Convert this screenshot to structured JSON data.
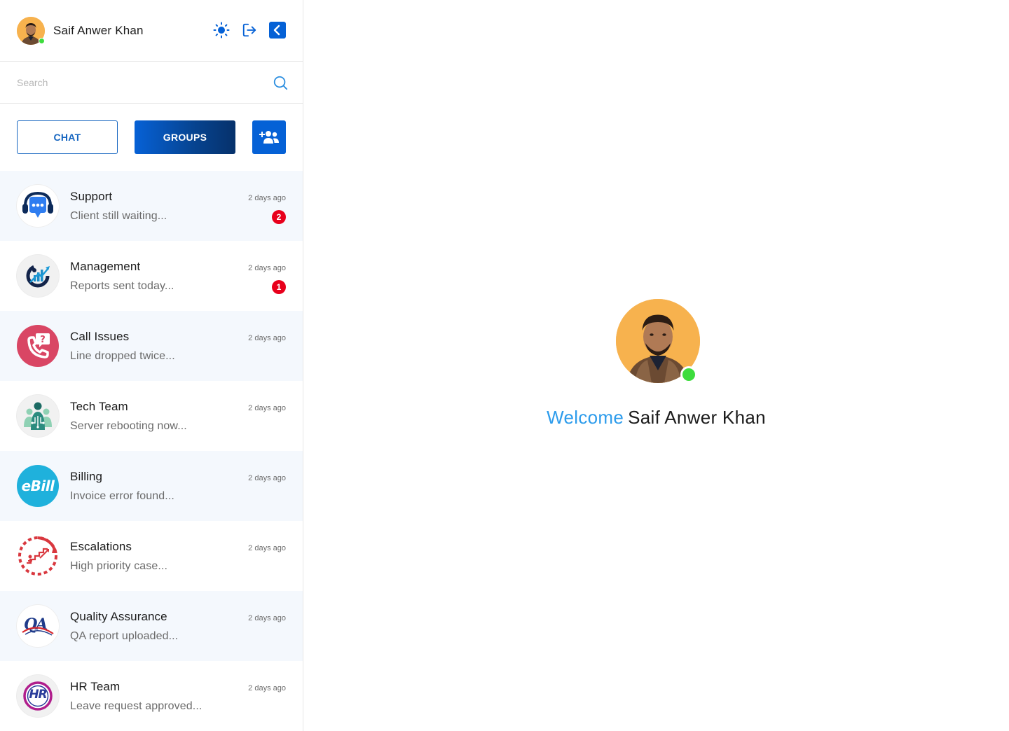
{
  "user": {
    "name": "Saif Anwer Khan",
    "status": "online"
  },
  "header": {
    "theme_icon": "sun-icon",
    "logout_icon": "logout-icon",
    "collapse_icon": "chevron-left-icon"
  },
  "search": {
    "placeholder": "Search",
    "value": "",
    "icon": "search-icon"
  },
  "tabs": {
    "chat_label": "CHAT",
    "groups_label": "GROUPS",
    "active": "GROUPS",
    "add_group_icon": "add-users-icon"
  },
  "groups": [
    {
      "name": "Support",
      "last_message": "Client still waiting...",
      "time": "2 days ago",
      "unread": "2",
      "icon": "support-headset-icon"
    },
    {
      "name": "Management",
      "last_message": "Reports sent today...",
      "time": "2 days ago",
      "unread": "1",
      "icon": "management-growth-icon"
    },
    {
      "name": "Call Issues",
      "last_message": "Line dropped twice...",
      "time": "2 days ago",
      "unread": "",
      "icon": "phone-question-icon"
    },
    {
      "name": "Tech Team",
      "last_message": "Server rebooting now...",
      "time": "2 days ago",
      "unread": "",
      "icon": "tech-team-icon"
    },
    {
      "name": "Billing",
      "last_message": "Invoice error found...",
      "time": "2 days ago",
      "unread": "",
      "icon": "ebill-logo",
      "logo_text": "eBill"
    },
    {
      "name": "Escalations",
      "last_message": "High priority case...",
      "time": "2 days ago",
      "unread": "",
      "icon": "escalation-icon"
    },
    {
      "name": "Quality Assurance",
      "last_message": "QA report uploaded...",
      "time": "2 days ago",
      "unread": "",
      "icon": "qa-logo",
      "logo_text": "QA"
    },
    {
      "name": "HR Team",
      "last_message": "Leave request approved...",
      "time": "2 days ago",
      "unread": "",
      "icon": "hr-logo",
      "logo_text": "HR"
    }
  ],
  "welcome": {
    "greeting": "Welcome",
    "name": "Saif Anwer Khan"
  },
  "colors": {
    "primary": "#0561d6",
    "accent_blue": "#2d9cec",
    "badge_red": "#e8001c",
    "online_green": "#3ddc3d",
    "row_alt": "#f4f8fd"
  }
}
